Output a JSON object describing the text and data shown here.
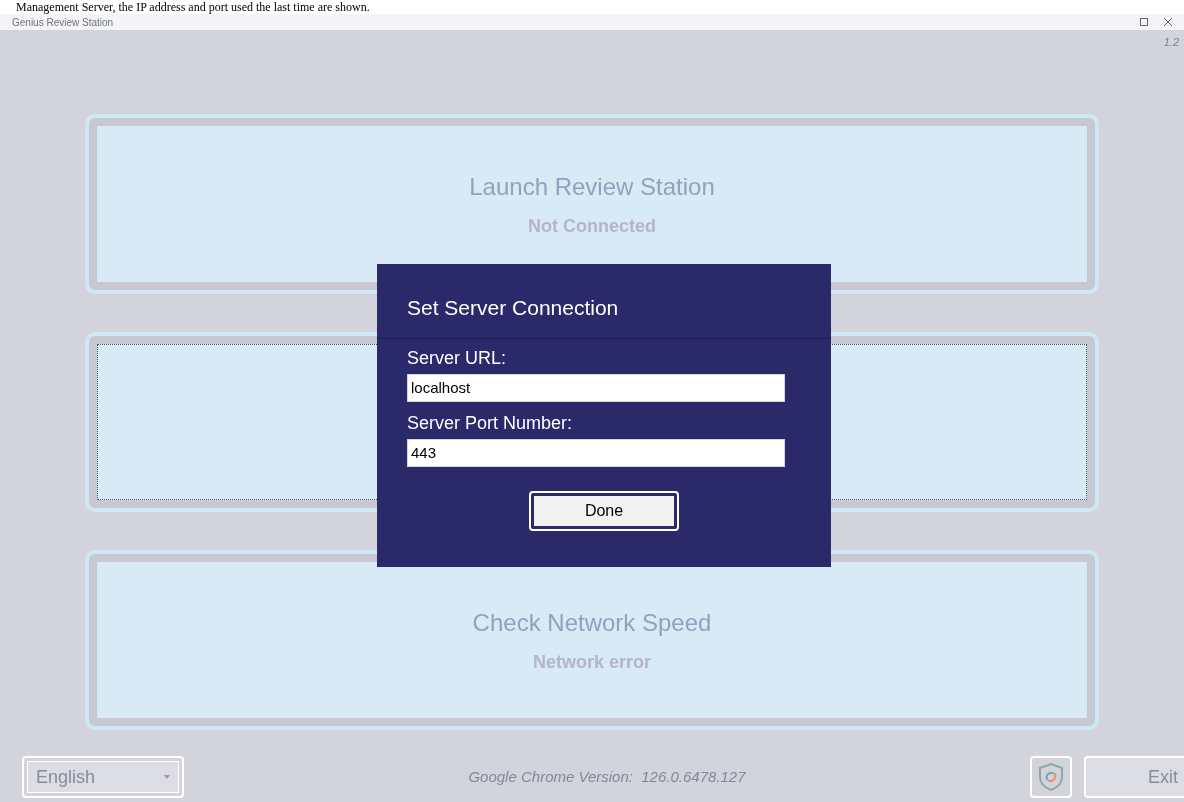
{
  "caption": "Management Server, the IP address and port used the last time are shown.",
  "window": {
    "title": "Genius Review Station",
    "version": "1.2"
  },
  "cards": [
    {
      "title": "Launch Review Station",
      "status": "Not Connected",
      "focused": false
    },
    {
      "focused": true
    },
    {
      "title": "Check Network Speed",
      "status": "Network error",
      "focused": false
    }
  ],
  "dialog": {
    "title": "Set Server Connection",
    "fields": [
      {
        "label": "Server URL:",
        "value": "localhost"
      },
      {
        "label": "Server Port Number:",
        "value": "443"
      }
    ],
    "button": "Done"
  },
  "footer": {
    "language": "English",
    "chrome_version": "Google Chrome Version:  126.0.6478.127",
    "exit": "Exit"
  }
}
